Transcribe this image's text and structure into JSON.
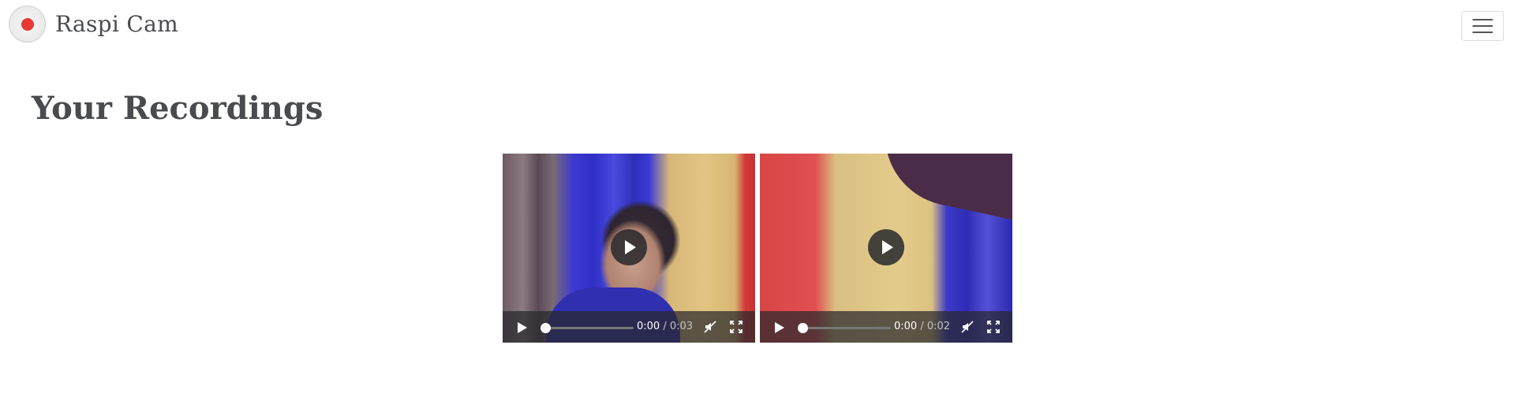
{
  "app": {
    "title": "Raspi Cam"
  },
  "colors": {
    "record_dot": "#e53935",
    "text": "#4a4b4f"
  },
  "icons": {
    "logo": "record-icon",
    "menu": "hamburger-menu-icon",
    "play": "play-icon",
    "mute": "volume-muted-icon",
    "fullscreen": "fullscreen-icon"
  },
  "main": {
    "heading": "Your Recordings",
    "videos": [
      {
        "current_time": "0:00",
        "separator": "/",
        "duration": "0:03",
        "progress": 0
      },
      {
        "current_time": "0:00",
        "separator": "/",
        "duration": "0:02",
        "progress": 0
      }
    ]
  }
}
